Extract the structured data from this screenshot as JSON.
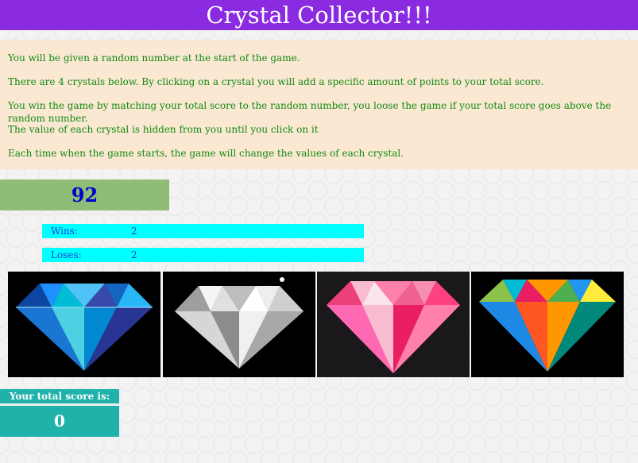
{
  "header": {
    "title": "Crystal Collector!!!"
  },
  "instructions": [
    "You will be given a random number at the start of the game.",
    "There are 4 crystals below. By clicking on a crystal you will add a specific amount of points to your total score.",
    "You win the game by matching your total score to the random number, you loose the game if your total score goes above the random number.",
    "The value of each crystal is hidden from you until you click on it",
    "Each time when the game starts, the game will change the values of each crystal."
  ],
  "game": {
    "target_number": "92",
    "wins_label": "Wins:",
    "wins_value": "2",
    "loses_label": "Loses:",
    "loses_value": "2",
    "score_label": "Your total score is:",
    "score_value": "0"
  },
  "crystals": [
    {
      "name": "blue-crystal",
      "color": "#1e90ff"
    },
    {
      "name": "clear-crystal",
      "color": "#e6e6e6"
    },
    {
      "name": "pink-crystal",
      "color": "#ff69b4"
    },
    {
      "name": "multicolor-crystal",
      "color": "#ff7f00"
    }
  ],
  "colors": {
    "header_bg": "#8a2be2",
    "instructions_bg": "#fbe8d3",
    "instructions_text": "#118a11",
    "target_bg": "#8fbc76",
    "target_text": "#0000cd",
    "stats_bg": "#00ffff",
    "score_bg": "#20b2aa"
  }
}
